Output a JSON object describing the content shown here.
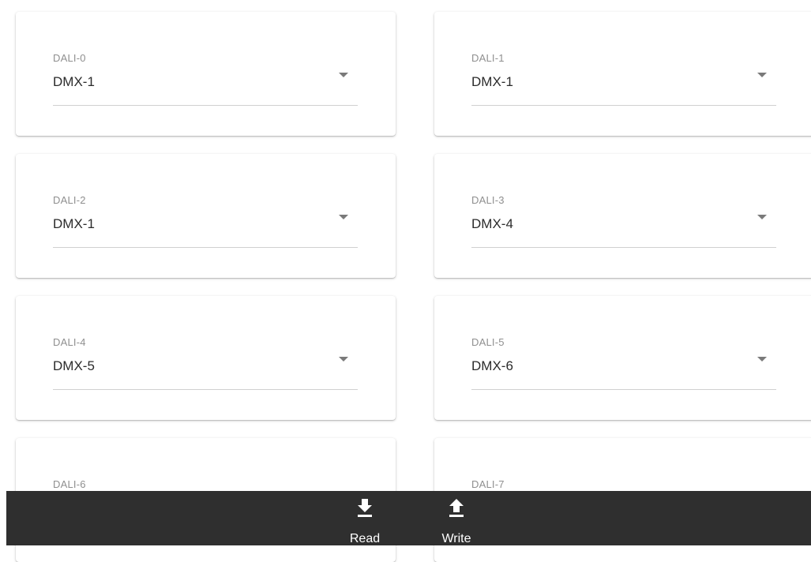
{
  "mappings": [
    {
      "label": "DALI-0",
      "value": "DMX-1"
    },
    {
      "label": "DALI-1",
      "value": "DMX-1"
    },
    {
      "label": "DALI-2",
      "value": "DMX-1"
    },
    {
      "label": "DALI-3",
      "value": "DMX-4"
    },
    {
      "label": "DALI-4",
      "value": "DMX-5"
    },
    {
      "label": "DALI-5",
      "value": "DMX-6"
    },
    {
      "label": "DALI-6",
      "value": ""
    },
    {
      "label": "DALI-7",
      "value": ""
    }
  ],
  "bottom_bar": {
    "read_label": "Read",
    "read_icon": "download-icon",
    "write_label": "Write",
    "write_icon": "upload-icon",
    "background": "#2f2f2f"
  }
}
